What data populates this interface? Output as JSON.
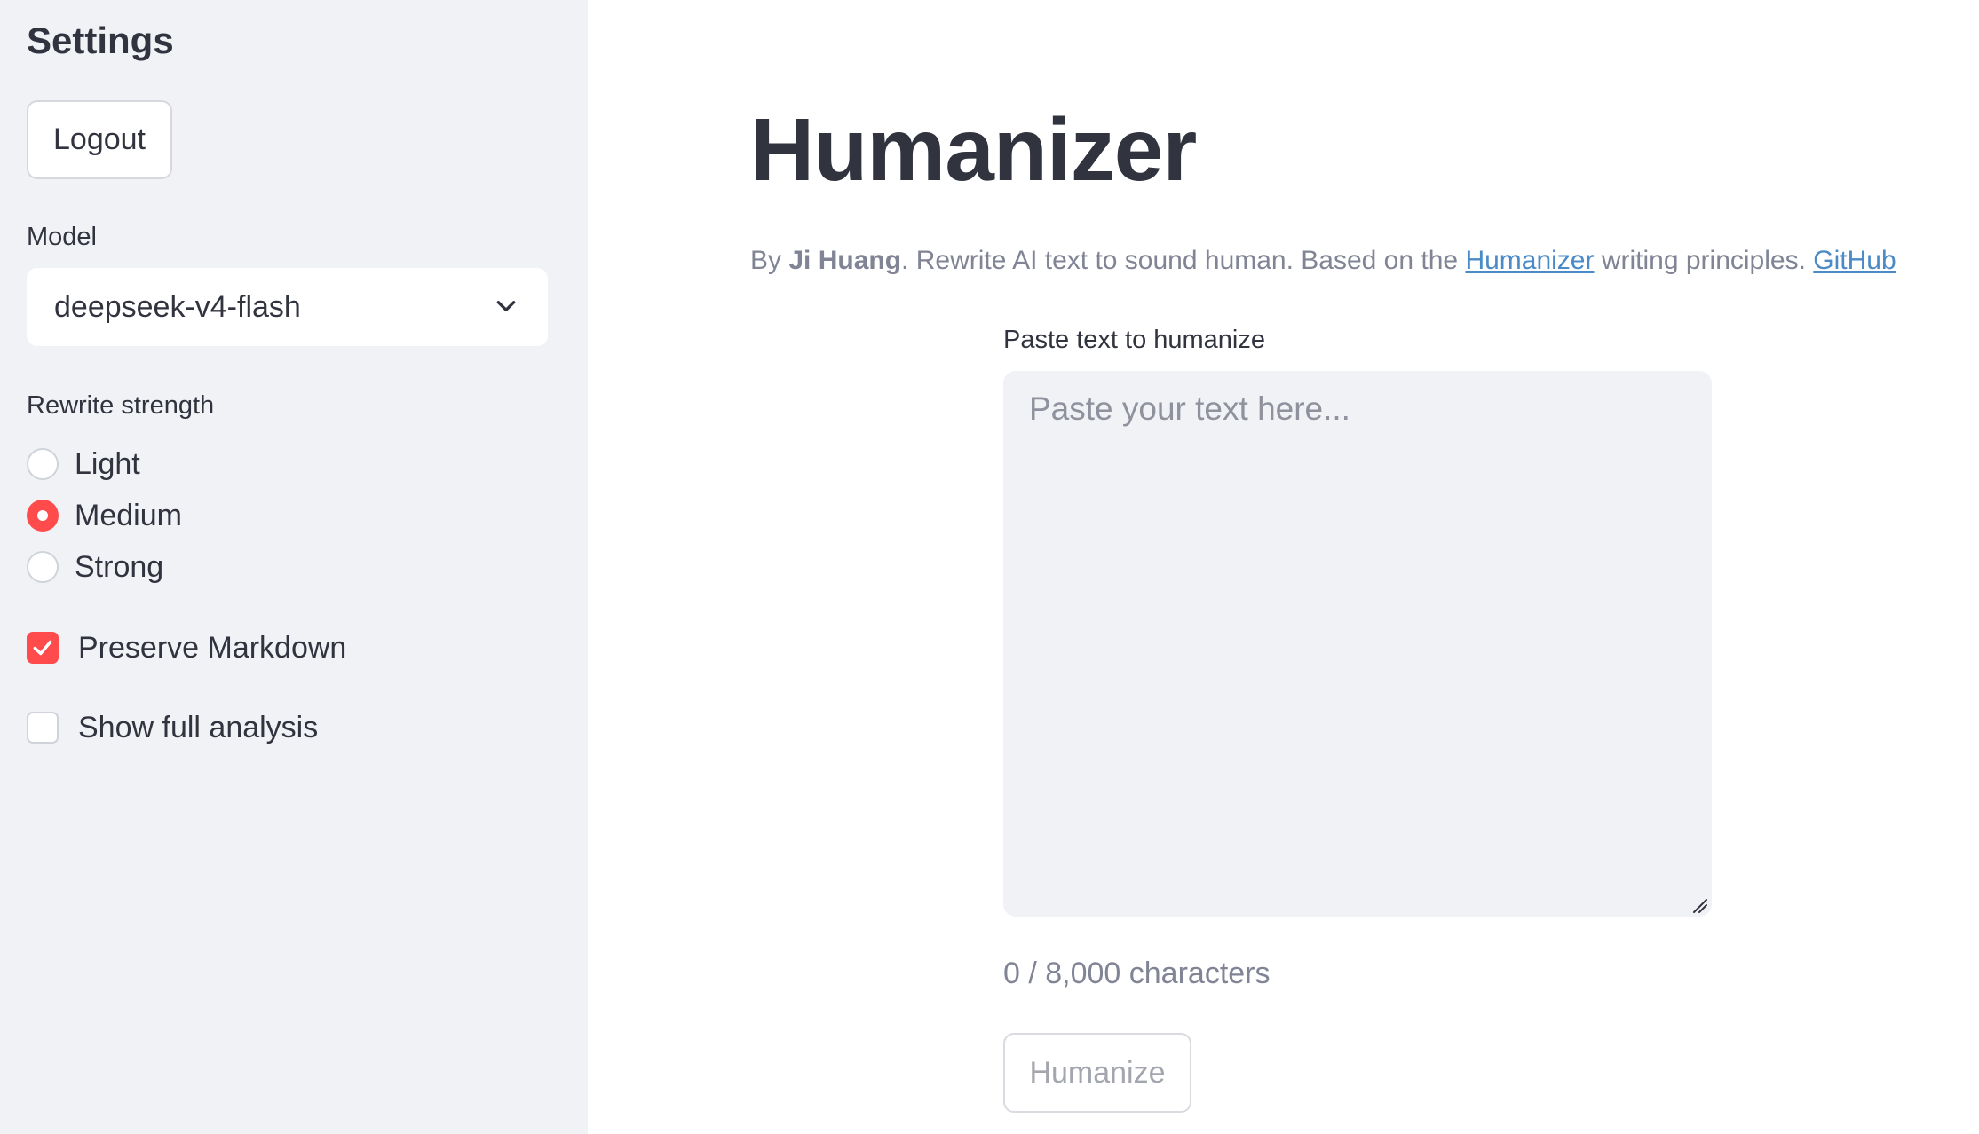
{
  "sidebar": {
    "title": "Settings",
    "logout_label": "Logout",
    "model": {
      "label": "Model",
      "selected": "deepseek-v4-flash"
    },
    "rewrite_strength": {
      "label": "Rewrite strength",
      "options": [
        {
          "label": "Light",
          "checked": false
        },
        {
          "label": "Medium",
          "checked": true
        },
        {
          "label": "Strong",
          "checked": false
        }
      ]
    },
    "preserve_markdown": {
      "label": "Preserve Markdown",
      "checked": true
    },
    "show_full_analysis": {
      "label": "Show full analysis",
      "checked": false
    }
  },
  "main": {
    "title": "Humanizer",
    "byline": {
      "prefix": "By ",
      "author": "Ji Huang",
      "middle": ". Rewrite AI text to sound human. Based on the ",
      "link1": "Humanizer",
      "suffix": " writing principles. ",
      "link2": "GitHub"
    },
    "input": {
      "label": "Paste text to humanize",
      "placeholder": "Paste your text here...",
      "value": ""
    },
    "char_count": "0 / 8,000 characters",
    "humanize_label": "Humanize"
  },
  "colors": {
    "accent": "#ff4b4b",
    "sidebar_bg": "#f0f2f6",
    "link": "#4a8ac7"
  }
}
